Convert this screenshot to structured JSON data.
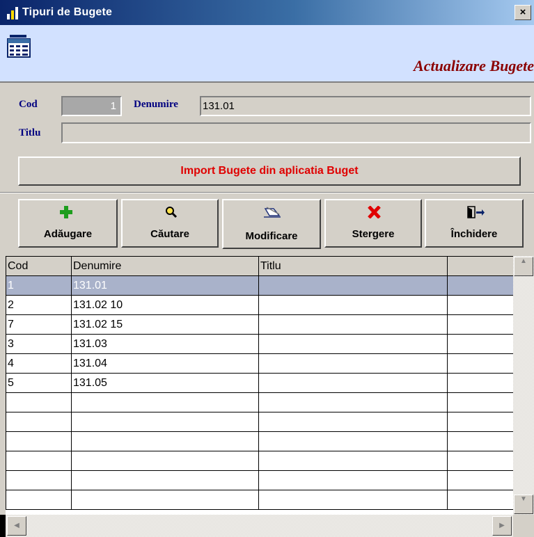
{
  "window": {
    "title": "Tipuri de Bugete",
    "close_label": "×"
  },
  "banner": {
    "subtitle": "Actualizare Bugete"
  },
  "form": {
    "cod_label": "Cod",
    "cod_value": "1",
    "denumire_label": "Denumire",
    "denumire_value": "131.01",
    "titlu_label": "Titlu",
    "titlu_value": ""
  },
  "import_button": "Import Bugete din aplicatia Buget",
  "toolbar": [
    {
      "label": "Adăugare",
      "icon": "plus-icon"
    },
    {
      "label": "Căutare",
      "icon": "search-icon"
    },
    {
      "label": "Modificare",
      "icon": "edit-icon"
    },
    {
      "label": "Stergere",
      "icon": "delete-icon"
    },
    {
      "label": "Închidere",
      "icon": "exit-icon"
    }
  ],
  "grid": {
    "columns": [
      "Cod",
      "Denumire",
      "Titlu",
      ""
    ],
    "rows": [
      {
        "cod": "1",
        "denumire": "131.01",
        "titlu": ""
      },
      {
        "cod": "2",
        "denumire": "131.02 10",
        "titlu": ""
      },
      {
        "cod": "7",
        "denumire": "131.02 15",
        "titlu": ""
      },
      {
        "cod": "3",
        "denumire": "131.03",
        "titlu": ""
      },
      {
        "cod": "4",
        "denumire": "131.04",
        "titlu": ""
      },
      {
        "cod": "5",
        "denumire": "131.05",
        "titlu": ""
      }
    ],
    "selected_row": 0
  },
  "colors": {
    "accent_red": "#e00000",
    "selection": "#a9b2ca",
    "banner_bg": "#d2e1ff"
  }
}
